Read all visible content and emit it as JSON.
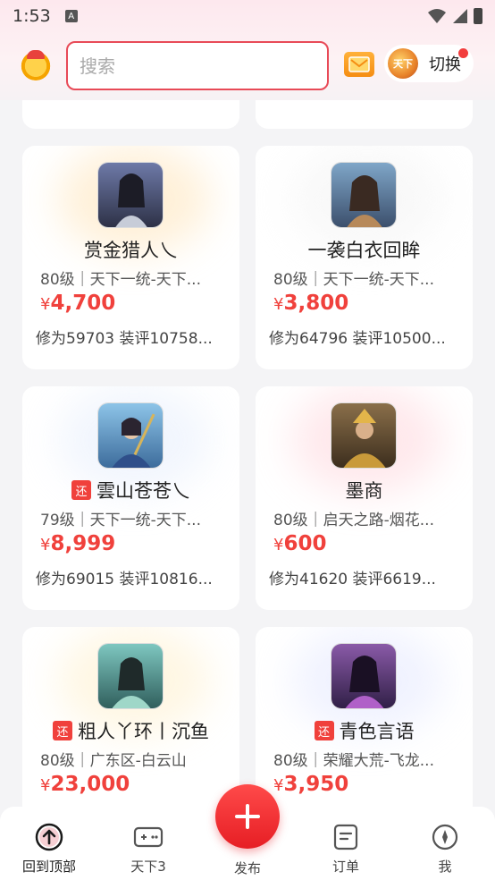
{
  "status_bar": {
    "time": "1:53",
    "badge": "A"
  },
  "header": {
    "search_placeholder": "搜索",
    "switch_label": "切换",
    "game_logo_text": "天下"
  },
  "colors": {
    "accent": "#f0413c",
    "search_border": "#e84a57"
  },
  "cards": [
    {
      "name": "赏金猎人乀",
      "returned": false,
      "server": "80级｜天下一统-天下...",
      "currency": "¥",
      "price": "4,700",
      "stats": "修为59703  装评10758...",
      "glow": "#ffe4b8"
    },
    {
      "name": "一袭白衣回眸",
      "returned": false,
      "server": "80级｜天下一统-天下...",
      "currency": "¥",
      "price": "3,800",
      "stats": "修为64796  装评10500...",
      "glow": "#f3f3f3"
    },
    {
      "name": "雲山苍苍乀",
      "returned": true,
      "server": "79级｜天下一统-天下...",
      "currency": "¥",
      "price": "8,999",
      "stats": "修为69015  装评10816...",
      "glow": "#e6eefc"
    },
    {
      "name": "墨商",
      "returned": false,
      "server": "80级｜启天之路-烟花...",
      "currency": "¥",
      "price": "600",
      "stats": "修为41620  装评6619...",
      "glow": "#ffd6dc"
    },
    {
      "name": "粗人丫环丨沉鱼",
      "returned": true,
      "server": "80级｜广东区-白云山",
      "currency": "¥",
      "price": "23,000",
      "stats": "",
      "glow": "#fff0cc"
    },
    {
      "name": "青色言语",
      "returned": true,
      "server": "80级｜荣耀大荒-飞龙...",
      "currency": "¥",
      "price": "3,950",
      "stats": "",
      "glow": "#e4e8ff"
    }
  ],
  "return_tag": "还",
  "nav": {
    "back_top": "回到顶部",
    "tianxia": "天下3",
    "publish": "发布",
    "orders": "订单",
    "me": "我"
  }
}
